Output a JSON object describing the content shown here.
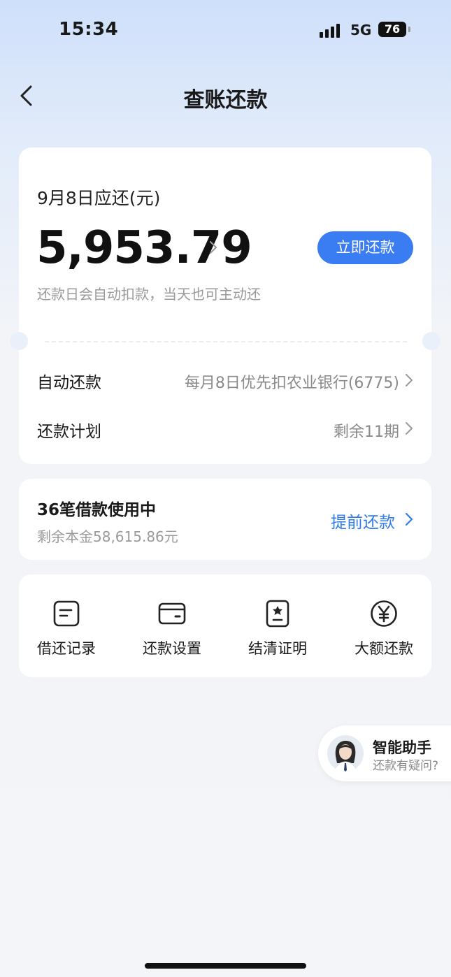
{
  "status": {
    "time": "15:34",
    "network": "5G",
    "battery": "76"
  },
  "nav": {
    "title": "查账还款"
  },
  "bill": {
    "due_label": "9月8日应还(元)",
    "amount": "5,953.79",
    "pay_button": "立即还款",
    "hint": "还款日会自动扣款，当天也可主动还",
    "auto_label": "自动还款",
    "auto_value": "每月8日优先扣农业银行(6775)",
    "plan_label": "还款计划",
    "plan_value": "剩余11期"
  },
  "loans": {
    "title": "36笔借款使用中",
    "remaining": "剩余本金58,615.86元",
    "prepay": "提前还款"
  },
  "actions": [
    {
      "label": "借还记录",
      "icon": "records-icon"
    },
    {
      "label": "还款设置",
      "icon": "wallet-icon"
    },
    {
      "label": "结清证明",
      "icon": "certificate-icon"
    },
    {
      "label": "大额还款",
      "icon": "yen-icon"
    }
  ],
  "assistant": {
    "title": "智能助手",
    "subtitle": "还款有疑问?"
  },
  "colors": {
    "accent": "#3a7cf2",
    "link": "#2f7bea"
  }
}
